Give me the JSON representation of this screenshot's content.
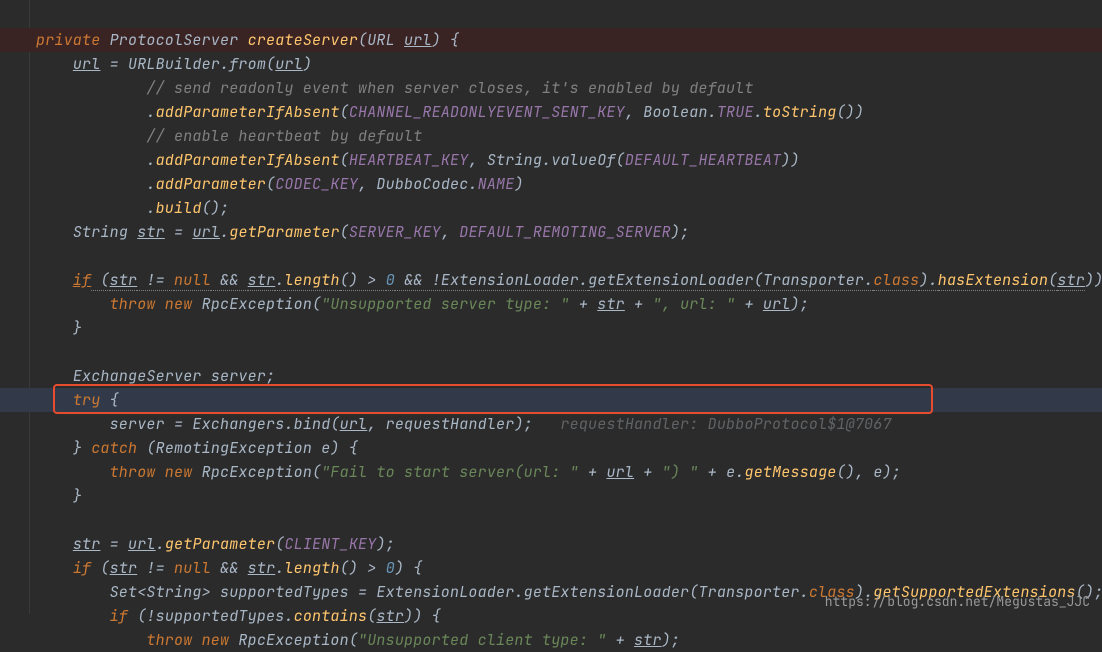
{
  "watermark": "https://blog.csdn.net/Megustas_JJC",
  "code": {
    "l1": {
      "kw1": "private",
      "type": "ProtocolServer",
      "method": "createServer",
      "arg_t": "URL",
      "arg_n": "url",
      "t": ") {"
    },
    "l2": {
      "v": "url",
      "t1": " = URLBuilder.",
      "m": "from",
      "t2": "(",
      "p": "url",
      "t3": ")"
    },
    "l3": {
      "c": "// send readonly event when server closes, it's enabled by default"
    },
    "l4": {
      "t1": ".",
      "m": "addParameterIfAbsent",
      "t2": "(",
      "c1": "CHANNEL_READONLYEVENT_SENT_KEY",
      "t3": ", Boolean.",
      "c2": "TRUE",
      "t4": ".",
      "m2": "toString",
      "t5": "())"
    },
    "l5": {
      "c": "// enable heartbeat by default"
    },
    "l6": {
      "t1": ".",
      "m": "addParameterIfAbsent",
      "t2": "(",
      "c1": "HEARTBEAT_KEY",
      "t3": ", String.",
      "m2": "valueOf",
      "t4": "(",
      "c2": "DEFAULT_HEARTBEAT",
      "t5": "))"
    },
    "l7": {
      "t1": ".",
      "m": "addParameter",
      "t2": "(",
      "c1": "CODEC_KEY",
      "t3": ", DubboCodec.",
      "c2": "NAME",
      "t4": ")"
    },
    "l8": {
      "t1": ".",
      "m": "build",
      "t2": "();"
    },
    "l9": {
      "t1": "String ",
      "v": "str",
      "t2": " = ",
      "p": "url",
      "t3": ".",
      "m": "getParameter",
      "t4": "(",
      "c1": "SERVER_KEY",
      "t5": ", ",
      "c2": "DEFAULT_REMOTING_SERVER",
      "t6": ");"
    },
    "l10": {
      "kw": "if",
      "t1": " (",
      "v1": "str",
      "kw2": "null",
      "t2": " && ",
      "v2": "str",
      "m": "length",
      "t3": "() > ",
      "n": "0",
      "t4": " && !ExtensionLoader.",
      "m2": "getExtensionLoader",
      "t5": "(Transporter.",
      "kw3": "class",
      "t6": ").",
      "m3": "hasExtension",
      "t7": "(",
      "v3": "str",
      "t8": ")) {",
      "ne": " != "
    },
    "l11": {
      "kw1": "throw new",
      "t1": " RpcException(",
      "s": "\"Unsupported server type: \"",
      "t2": " + ",
      "v1": "str",
      "t3": " + ",
      "s2": "\", url: \"",
      "t4": " + ",
      "v2": "url",
      "t5": ");"
    },
    "l12": {
      "t": "}"
    },
    "l13": {
      "t": "ExchangeServer server;"
    },
    "l14": {
      "kw": "try",
      "t": " {"
    },
    "l15": {
      "t1": "server = Exchangers.",
      "m": "bind",
      "t2": "(",
      "p": "url",
      "t3": ", requestHandler);",
      "hint": "   requestHandler: DubboProtocol$1@7067"
    },
    "l16": {
      "t1": "} ",
      "kw": "catch",
      "t2": " (RemotingException e) {"
    },
    "l17": {
      "kw1": "throw new",
      "t1": " RpcException(",
      "s": "\"Fail to start server(url: \"",
      "t2": " + ",
      "v": "url",
      "t3": " + ",
      "s2": "\") \"",
      "t4": " + e.",
      "m": "getMessage",
      "t5": "(), e);"
    },
    "l18": {
      "t": "}"
    },
    "l19": {
      "v": "str",
      "t1": " = ",
      "p": "url",
      "t2": ".",
      "m": "getParameter",
      "t3": "(",
      "c": "CLIENT_KEY",
      "t4": ");"
    },
    "l20": {
      "kw": "if",
      "t1": " (",
      "v": "str",
      "t2": " != ",
      "kw2": "null",
      "t3": " && ",
      "v2": "str",
      "t4": ".",
      "m": "length",
      "t5": "() > ",
      "n": "0",
      "t6": ") {"
    },
    "l21": {
      "t1": "Set<String> supportedTypes = ExtensionLoader.",
      "m": "getExtensionLoader",
      "t2": "(Transporter.",
      "kw": "class",
      "t3": ").",
      "m2": "getSupportedExtensions",
      "t4": "();"
    },
    "l22": {
      "kw": "if",
      "t1": " (!supportedTypes.",
      "m": "contains",
      "t2": "(",
      "v": "str",
      "t3": ")) {"
    },
    "l23": {
      "kw1": "throw new",
      "t1": " RpcException(",
      "s": "\"Unsupported client type: \"",
      "t2": " + ",
      "v": "str",
      "t3": ");"
    }
  }
}
